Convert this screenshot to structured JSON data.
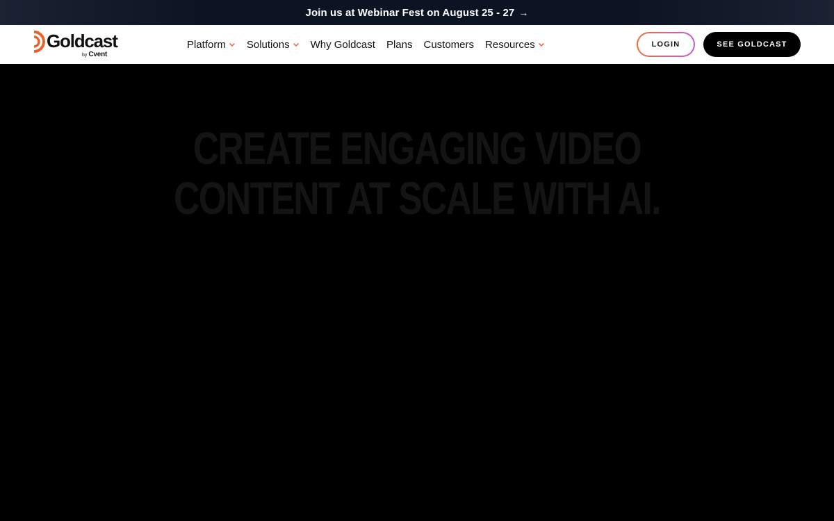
{
  "announcement": {
    "text": "Join us at Webinar Fest on August 25 - 27",
    "arrow": "→"
  },
  "logo": {
    "word": "Goldcast",
    "by": "by",
    "brand": "Cvent",
    "mark_color": "#e8632b"
  },
  "nav": {
    "items": [
      {
        "label": "Platform",
        "has_dropdown": true
      },
      {
        "label": "Solutions",
        "has_dropdown": true
      },
      {
        "label": "Why Goldcast",
        "has_dropdown": false
      },
      {
        "label": "Plans",
        "has_dropdown": false
      },
      {
        "label": "Customers",
        "has_dropdown": false
      },
      {
        "label": "Resources",
        "has_dropdown": true
      }
    ],
    "chevron_color": "#e8632b"
  },
  "actions": {
    "login_label": "LOGIN",
    "see_label": "SEE GOLDCAST"
  },
  "hero": {
    "line1": "CREATE ENGAGING VIDEO",
    "line2": "CONTENT AT SCALE WITH AI."
  }
}
